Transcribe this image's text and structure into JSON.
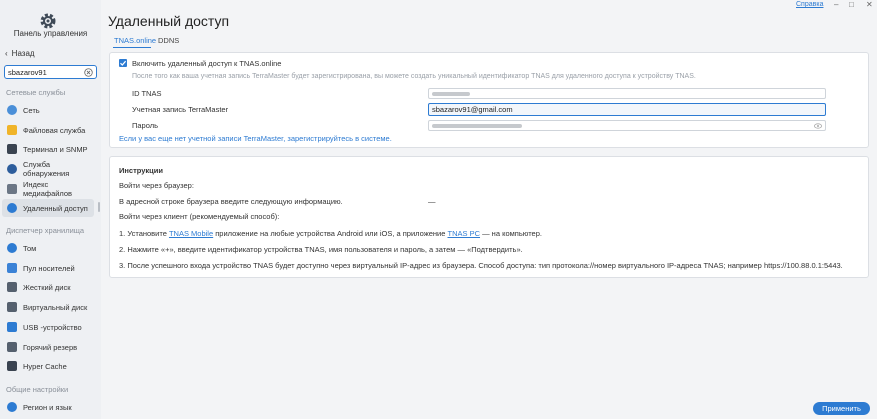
{
  "sidebar": {
    "title": "Панель управления",
    "back_label": "Назад",
    "search_value": "sbazarov91",
    "sections": {
      "network": "Сетевые службы",
      "storage": "Диспетчер хранилища",
      "general": "Общие настройки"
    },
    "network_items": [
      {
        "label": "Сеть",
        "icon": "globe-icon"
      },
      {
        "label": "Файловая служба",
        "icon": "folder-icon"
      },
      {
        "label": "Терминал и SNMP",
        "icon": "terminal-icon"
      },
      {
        "label": "Служба обнаружения",
        "icon": "discovery-icon"
      },
      {
        "label": "Индекс медиафайлов",
        "icon": "media-index-icon"
      },
      {
        "label": "Удаленный доступ",
        "icon": "cloud-icon"
      }
    ],
    "storage_items": [
      {
        "label": "Том",
        "icon": "volume-icon"
      },
      {
        "label": "Пул носителей",
        "icon": "storage-pool-icon"
      },
      {
        "label": "Жесткий диск",
        "icon": "hard-disk-icon"
      },
      {
        "label": "Виртуальный диск",
        "icon": "virtual-disk-icon"
      },
      {
        "label": "USB -устройство",
        "icon": "usb-icon"
      },
      {
        "label": "Горячий резерв",
        "icon": "hot-spare-icon"
      },
      {
        "label": "Hyper Cache",
        "icon": "cache-icon"
      }
    ],
    "general_items": [
      {
        "label": "Регион и язык",
        "icon": "region-icon"
      }
    ]
  },
  "window": {
    "help_label": "Справка",
    "controls": [
      "–",
      "□",
      "✕"
    ]
  },
  "main": {
    "title": "Удаленный доступ",
    "tabs": [
      {
        "label": "TNAS.online",
        "active": true
      },
      {
        "label": "DDNS",
        "active": false
      }
    ],
    "tnas": {
      "enable_label": "Включить удаленный доступ к TNAS.online",
      "enabled": true,
      "hint": "После того как ваша учетная запись TerraMaster будет зарегистрирована, вы можете создать уникальный идентификатор TNAS для удаленного доступа к устройству TNAS.",
      "id_label": "ID TNAS",
      "account_label": "Учетная запись TerraMaster",
      "account_value": "sbazarov91@gmail.com",
      "password_label": "Пароль",
      "register_link": "Если у вас еще нет учетной записи TerraMaster, зарегистрируйтесь в системе."
    },
    "instructions": {
      "title": "Инструкции",
      "browser_login": "Войти через браузер:",
      "address_line": "В адресной строке браузера введите следующую информацию.",
      "address_value": "—",
      "client_login": "Войти через клиент (рекомендуемый способ):",
      "step1_pre": "1. Установите ",
      "step1_link1": "TNAS Mobile",
      "step1_mid": " приложение на любые устройства Android или iOS, а приложение ",
      "step1_link2": "TNAS PC",
      "step1_post": " — на компьютер.",
      "step2": "2. Нажмите «+», введите идентификатор устройства TNAS, имя пользователя и пароль, а затем — «Подтвердить».",
      "step3": "3. После успешного входа устройство TNAS будет доступно через виртуальный IP-адрес из браузера. Способ доступа: тип протокола://номер виртуального IP-адреса TNAS; например https://100.88.0.1:5443."
    },
    "apply_label": "Применить"
  },
  "colors": {
    "accent": "#2d7bd2",
    "sidebar_bg": "#eef0f3",
    "page_bg": "#f3f4f6"
  }
}
